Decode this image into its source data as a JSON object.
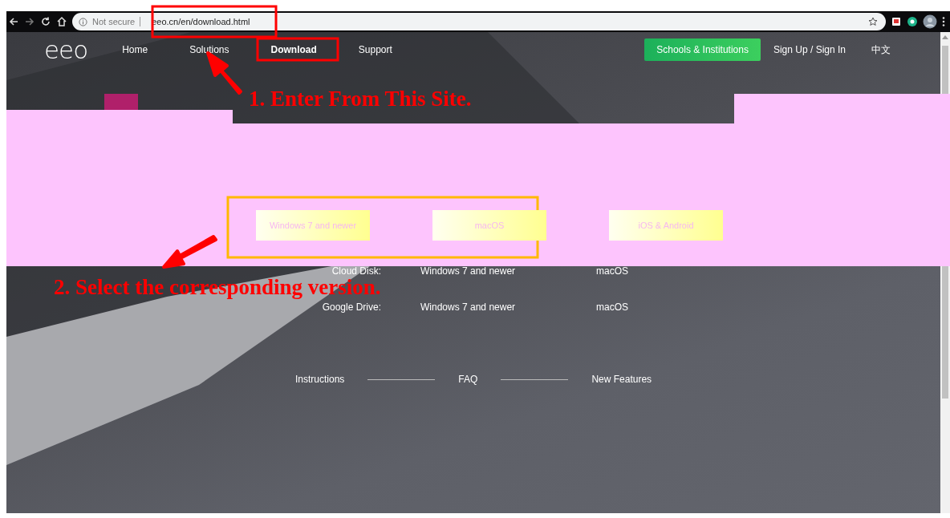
{
  "browser": {
    "security_label": "Not secure",
    "url": "eeo.cn/en/download.html"
  },
  "site_nav": {
    "logo": "eeo",
    "links": [
      {
        "label": "Home",
        "selected": false
      },
      {
        "label": "Solutions",
        "selected": false
      },
      {
        "label": "Download",
        "selected": true
      },
      {
        "label": "Support",
        "selected": false
      }
    ],
    "institutions_button": "Schools & Institutions",
    "sign_in": "Sign Up / Sign In",
    "language": "中文"
  },
  "download_buttons": [
    "Windows 7 and newer",
    "macOS",
    "iOS & Android"
  ],
  "mirror_rows": [
    {
      "label": "Cloud Disk:",
      "windows": "Windows 7 and newer",
      "mac": "macOS"
    },
    {
      "label": "Google Drive:",
      "windows": "Windows 7 and newer",
      "mac": "macOS"
    }
  ],
  "footer_links": [
    "Instructions",
    "FAQ",
    "New Features"
  ],
  "annotations": [
    "1. Enter From This Site.",
    "2. Select the corresponding version."
  ]
}
